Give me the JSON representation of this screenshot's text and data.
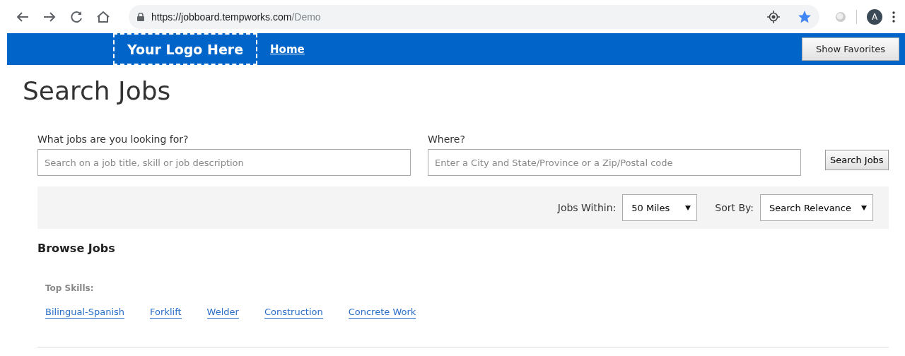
{
  "browser": {
    "url_host": "https://jobboard.tempworks.com",
    "url_path": "/Demo",
    "avatar": "A",
    "bookmarked": true
  },
  "header": {
    "logo": "Your Logo Here",
    "nav": [
      {
        "label": "Home",
        "selected": true
      }
    ],
    "favorites_button": "Show Favorites"
  },
  "title": "Search Jobs",
  "search": {
    "what_label": "What jobs are you looking for?",
    "what_placeholder": "Search on a job title, skill or job description",
    "where_label": "Where?",
    "where_placeholder": "Enter a City and State/Province or a Zip/Postal code",
    "button": "Search Jobs"
  },
  "filters": {
    "within_label": "Jobs Within:",
    "within_value": "50 Miles",
    "sort_label": "Sort By:",
    "sort_value": "Search Relevance"
  },
  "browse": {
    "heading": "Browse Jobs",
    "skills_label": "Top Skills:",
    "skills": [
      "Bilingual-Spanish",
      "Forklift",
      "Welder",
      "Construction",
      "Concrete Work"
    ]
  }
}
